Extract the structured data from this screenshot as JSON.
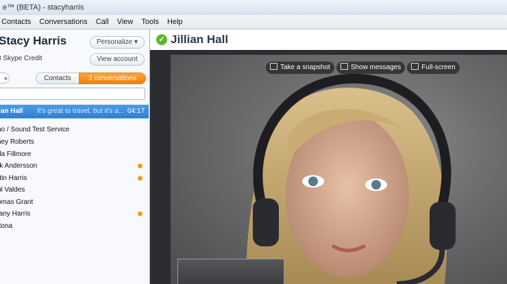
{
  "window": {
    "title": "e™ (BETA) - stacyharris"
  },
  "menu": {
    "items": [
      "Contacts",
      "Conversations",
      "Call",
      "View",
      "Tools",
      "Help"
    ]
  },
  "profile": {
    "name": "Stacy Harris",
    "personalize_label": "Personalize ▾",
    "credit": "3 Skype Credit",
    "view_account_label": "View account"
  },
  "tabs": {
    "back_label": "«",
    "contacts_label": "Contacts",
    "conversations_label": "3 conversations"
  },
  "active_conversation": {
    "name": "ian Hall",
    "message": "It's great to travel, but it's a...",
    "time": "04:17"
  },
  "contacts": [
    {
      "name": "ho / Sound Test Service",
      "unread": false
    },
    {
      "name": "ney Roberts",
      "unread": false
    },
    {
      "name": "da Fillmore",
      "unread": false
    },
    {
      "name": "rk Andersson",
      "unread": true
    },
    {
      "name": "rtin Harris",
      "unread": true
    },
    {
      "name": "ul Valdes",
      "unread": false
    },
    {
      "name": "omas Grant",
      "unread": false
    },
    {
      "name": "fany Harris",
      "unread": true
    },
    {
      "name": "ttona",
      "unread": false
    }
  ],
  "chat": {
    "title": "Jillian Hall",
    "status_icon": "skype-online-icon"
  },
  "video_toolbar": {
    "snapshot_label": "Take a snapshot",
    "messages_label": "Show messages",
    "fullscreen_label": "Full-screen"
  },
  "colors": {
    "accent_orange": "#f37f0a",
    "selection_blue": "#2f7fd1",
    "online_green": "#5cb82a"
  }
}
